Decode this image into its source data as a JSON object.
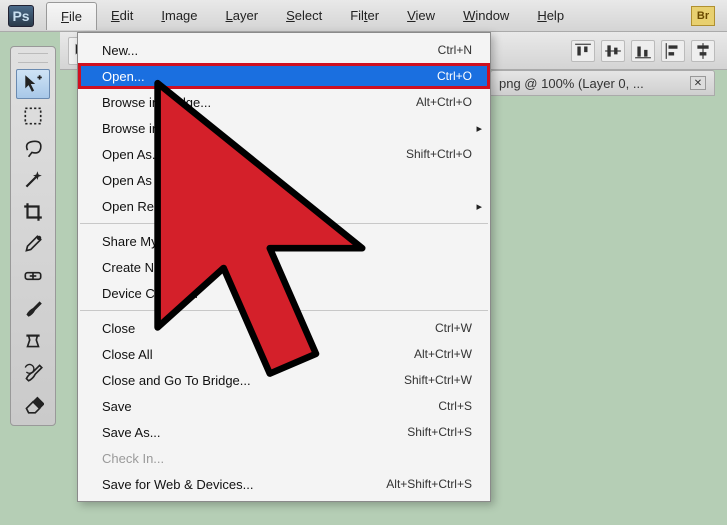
{
  "app": {
    "logo": "Ps",
    "br_badge": "Br"
  },
  "menubar": {
    "items": [
      {
        "label": "File",
        "key": "F",
        "open": true
      },
      {
        "label": "Edit",
        "key": "E"
      },
      {
        "label": "Image",
        "key": "I"
      },
      {
        "label": "Layer",
        "key": "L"
      },
      {
        "label": "Select",
        "key": "S"
      },
      {
        "label": "Filter",
        "key": "t"
      },
      {
        "label": "View",
        "key": "V"
      },
      {
        "label": "Window",
        "key": "W"
      },
      {
        "label": "Help",
        "key": "H"
      }
    ]
  },
  "document": {
    "title": "png @ 100% (Layer 0, ..."
  },
  "file_menu": {
    "groups": [
      [
        {
          "label": "New...",
          "shortcut": "Ctrl+N"
        },
        {
          "label": "Open...",
          "shortcut": "Ctrl+O",
          "highlight": true,
          "boxed": true
        },
        {
          "label": "Browse in Bridge...",
          "shortcut": "Alt+Ctrl+O"
        },
        {
          "label": "Browse in",
          "submenu": true
        },
        {
          "label": "Open As...",
          "shortcut": "Shift+Ctrl+O"
        },
        {
          "label": "Open As Sma"
        },
        {
          "label": "Open Recent",
          "submenu": true
        }
      ],
      [
        {
          "label": "Share My Screen..."
        },
        {
          "label": "Create New Review..."
        },
        {
          "label": "Device Central..."
        }
      ],
      [
        {
          "label": "Close",
          "shortcut": "Ctrl+W"
        },
        {
          "label": "Close All",
          "shortcut": "Alt+Ctrl+W"
        },
        {
          "label": "Close and Go To Bridge...",
          "shortcut": "Shift+Ctrl+W"
        },
        {
          "label": "Save",
          "shortcut": "Ctrl+S"
        },
        {
          "label": "Save As...",
          "shortcut": "Shift+Ctrl+S"
        },
        {
          "label": "Check In...",
          "disabled": true
        },
        {
          "label": "Save for Web & Devices...",
          "shortcut": "Alt+Shift+Ctrl+S"
        }
      ]
    ]
  },
  "tools": [
    {
      "name": "move-tool",
      "selected": true
    },
    {
      "name": "marquee-tool"
    },
    {
      "name": "lasso-tool"
    },
    {
      "name": "magic-wand-tool"
    },
    {
      "name": "crop-tool"
    },
    {
      "name": "eyedropper-tool"
    },
    {
      "name": "healing-brush-tool"
    },
    {
      "name": "brush-tool"
    },
    {
      "name": "clone-stamp-tool"
    },
    {
      "name": "history-brush-tool"
    },
    {
      "name": "eraser-tool"
    }
  ],
  "cursor": {
    "color_fill": "#d4202a",
    "color_stroke": "#000000"
  }
}
